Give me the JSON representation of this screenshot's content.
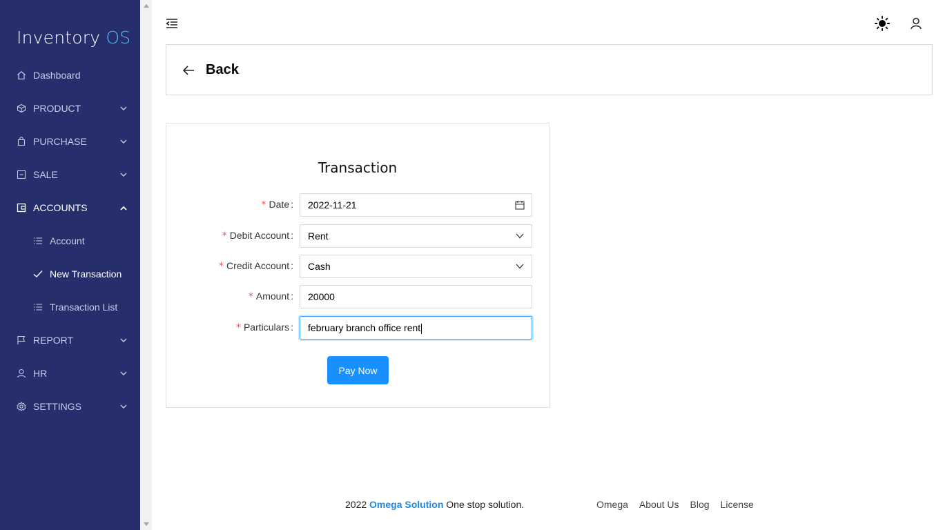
{
  "sidebar": {
    "brand_main": "Inventory",
    "brand_accent": "OS",
    "items": [
      {
        "label": "Dashboard"
      },
      {
        "label": "PRODUCT"
      },
      {
        "label": "PURCHASE"
      },
      {
        "label": "SALE"
      },
      {
        "label": "ACCOUNTS"
      },
      {
        "label": "Account"
      },
      {
        "label": "New Transaction"
      },
      {
        "label": "Transaction List"
      },
      {
        "label": "REPORT"
      },
      {
        "label": "HR"
      },
      {
        "label": "SETTINGS"
      }
    ]
  },
  "header": {
    "back_label": "Back",
    "icons": [
      "menu-fold-icon",
      "sun-icon",
      "user-icon"
    ]
  },
  "form": {
    "title": "Transaction",
    "date": {
      "label": "Date",
      "value": "2022-11-21"
    },
    "debit": {
      "label": "Debit Account",
      "value": "Rent"
    },
    "credit": {
      "label": "Credit Account",
      "value": "Cash"
    },
    "amount": {
      "label": "Amount",
      "value": "20000"
    },
    "particulars": {
      "label": "Particulars",
      "value": "february branch office rent"
    },
    "submit_label": "Pay Now"
  },
  "footer": {
    "year": "2022",
    "company": "Omega Solution",
    "tagline": "One stop solution.",
    "links": [
      "Omega",
      "About Us",
      "Blog",
      "License"
    ]
  },
  "colors": {
    "sidebar_bg": "#262f6b",
    "accent": "#1890ff",
    "required": "#ff4d4f",
    "brand_accent": "#5db6f2"
  }
}
